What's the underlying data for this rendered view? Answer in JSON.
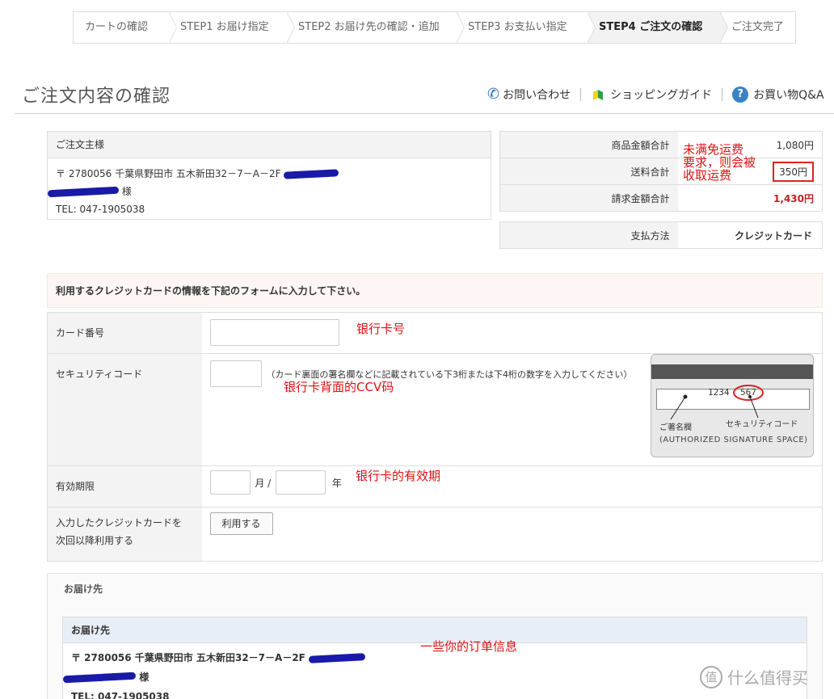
{
  "steps": [
    {
      "label": "カートの確認"
    },
    {
      "label": "STEP1 お届け指定"
    },
    {
      "label": "STEP2 お届け先の確認・追加"
    },
    {
      "label": "STEP3 お支払い指定"
    },
    {
      "label": "STEP4 ご注文の確認"
    },
    {
      "label": "ご注文完了"
    }
  ],
  "header": {
    "title": "ご注文内容の確認",
    "links": {
      "contact": "お問い合わせ",
      "guide": "ショッピングガイド",
      "qa": "お買い物Q&A",
      "qa_icon_text": "?"
    }
  },
  "owner": {
    "heading": "ご注文主様",
    "address": "〒 2780056 千葉県野田市 五木新田32－7－A－2F",
    "name_suffix": "様",
    "tel": "TEL: 047-1905038"
  },
  "totals": {
    "rows": [
      {
        "label": "商品金額合計",
        "value": "1,080円"
      },
      {
        "label": "送料合計",
        "value": "350円"
      },
      {
        "label": "請求金額合計",
        "value": "1,430円"
      }
    ],
    "payment_label": "支払方法",
    "payment_value": "クレジットカード"
  },
  "annotations": {
    "shipping_note_1": "未满免运费",
    "shipping_note_2": "要求，则会被",
    "shipping_note_3": "收取运费",
    "card_number": "银行卡号",
    "cvv": "银行卡背面的CCV码",
    "expiry": "银行卡的有效期",
    "order_info": "一些你的订单信息"
  },
  "card_form": {
    "notice": "利用するクレジットカードの情報を下記のフォームに入力して下さい。",
    "card_number_label": "カード番号",
    "security_label": "セキュリティコード",
    "security_hint": "（カード裏面の署名欄などに記載されている下3桁または下4桁の数字を入力してください）",
    "expiry_label": "有効期限",
    "month_unit": "月 /",
    "year_unit": "年",
    "save_label_1": "入力したクレジットカードを",
    "save_label_2": "次回以降利用する",
    "save_button": "利用する"
  },
  "card_image": {
    "digits": "1234",
    "code": "567",
    "sign_label": "ご著名欄",
    "security_label": "セキュリティコード",
    "footer": "(AUTHORIZED SIGNATURE SPACE)"
  },
  "delivery": {
    "section_title": "お届け先",
    "heading": "お届け先",
    "address": "〒 2780056 千葉県野田市 五木新田32－7－A－2F",
    "name_suffix": "様",
    "tel": "TEL: 047-1905038"
  },
  "watermark": {
    "icon": "值",
    "text": "什么值得买"
  },
  "colors": {
    "accent_red": "#d11111",
    "grand_total": "#bb2222",
    "redaction": "#1a1aa8"
  }
}
